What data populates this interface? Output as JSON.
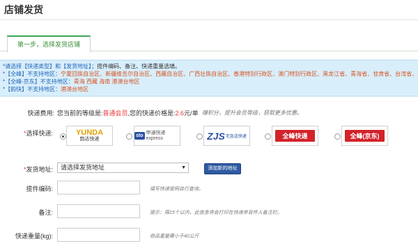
{
  "page": {
    "title": "店铺发货"
  },
  "tabs": [
    {
      "label": "第一步，选择发货店铺"
    }
  ],
  "notice": {
    "lines": [
      {
        "prefix": "*请选择【快递类型】和【发货地址】；",
        "text": "揽件编码、备注、快递重量选填。"
      },
      {
        "prefix": "*【全峰】不支持地区：",
        "text": "宁夏回族自治区、新疆维吾尔自治区、西藏自治区、广西壮族自治区、香港特别行政区、澳门特别行政区、黑龙江省、青海省、甘肃省、台湾省、海南省"
      },
      {
        "prefix": "*【全峰-京东】不支持地区：",
        "text": "青海 西藏 海南 港澳台地区"
      },
      {
        "prefix": "*【韵快】不支持地区：",
        "text": "港澳台地区"
      }
    ]
  },
  "fee": {
    "label": "快递费用:",
    "text_before": "您当前的等级是:",
    "level": "普通会员",
    "text_mid": ",您的快递价格是:",
    "price": "2.6",
    "unit": "元/单",
    "hint": "赚积分，提升会员等级，获取更多优惠。"
  },
  "courier": {
    "label": "选择快递:",
    "options": [
      {
        "name": "YUNDA",
        "sub": "韵达快递",
        "icon": "yunda-logo",
        "selected": true
      },
      {
        "name": "sto",
        "sub": "申通快递 express",
        "icon": "sto-logo",
        "selected": false
      },
      {
        "name": "ZJS",
        "sub": "宅急送快递",
        "icon": "zjs-logo",
        "selected": false
      },
      {
        "name": "全峰快递",
        "sub": "",
        "icon": "quanfeng-logo",
        "selected": false
      },
      {
        "name": "全峰(京东)",
        "sub": "",
        "icon": "quanfeng-jd-logo",
        "selected": false
      }
    ]
  },
  "address": {
    "label": "发货地址:",
    "value": "请选择发货地址",
    "add_button": "添加新的地址"
  },
  "pickup_code": {
    "label": "揽件编码:",
    "value": "",
    "hint": "填写快递官网自行查询。"
  },
  "remark": {
    "label": "备注:",
    "value": "",
    "hint": "提示：限15个以内，此信息将会打印在快递单背件人备注栏。"
  },
  "weight": {
    "label": "快递重量(kg):",
    "value": "",
    "hint": "商品重量需小于40公斤"
  },
  "colors": {
    "accent_green": "#3aa655",
    "notice_bg": "#d8eefb",
    "required_red": "#e33",
    "button_blue": "#2f5aa2"
  }
}
